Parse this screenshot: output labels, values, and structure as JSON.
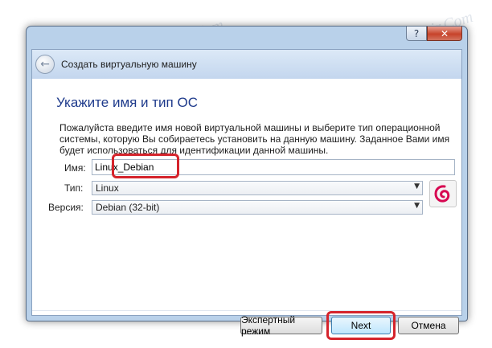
{
  "window": {
    "help_button": "?",
    "close_button": "✕"
  },
  "wizard": {
    "back_icon": "arrow-left-icon",
    "title": "Создать виртуальную машину"
  },
  "page": {
    "heading": "Укажите имя и тип ОС",
    "description": "Пожалуйста введите имя новой виртуальной машины и выберите тип операционной системы, которую Вы собираетесь установить на данную машину. Заданное Вами имя будет использоваться для идентификации данной машины."
  },
  "form": {
    "name_label": "Имя:",
    "name_value": "Linux_Debian",
    "type_label": "Тип:",
    "type_value": "Linux",
    "version_label": "Версия:",
    "version_value": "Debian (32-bit)",
    "os_icon": "debian-swirl-icon"
  },
  "buttons": {
    "expert": "Экспертный режим",
    "next": "Next",
    "cancel": "Отмена"
  },
  "watermark": "Sovinghrnrenair.Com",
  "colors": {
    "highlight": "#d5242c",
    "heading": "#1f3b8c",
    "debian_red": "#d70751"
  }
}
